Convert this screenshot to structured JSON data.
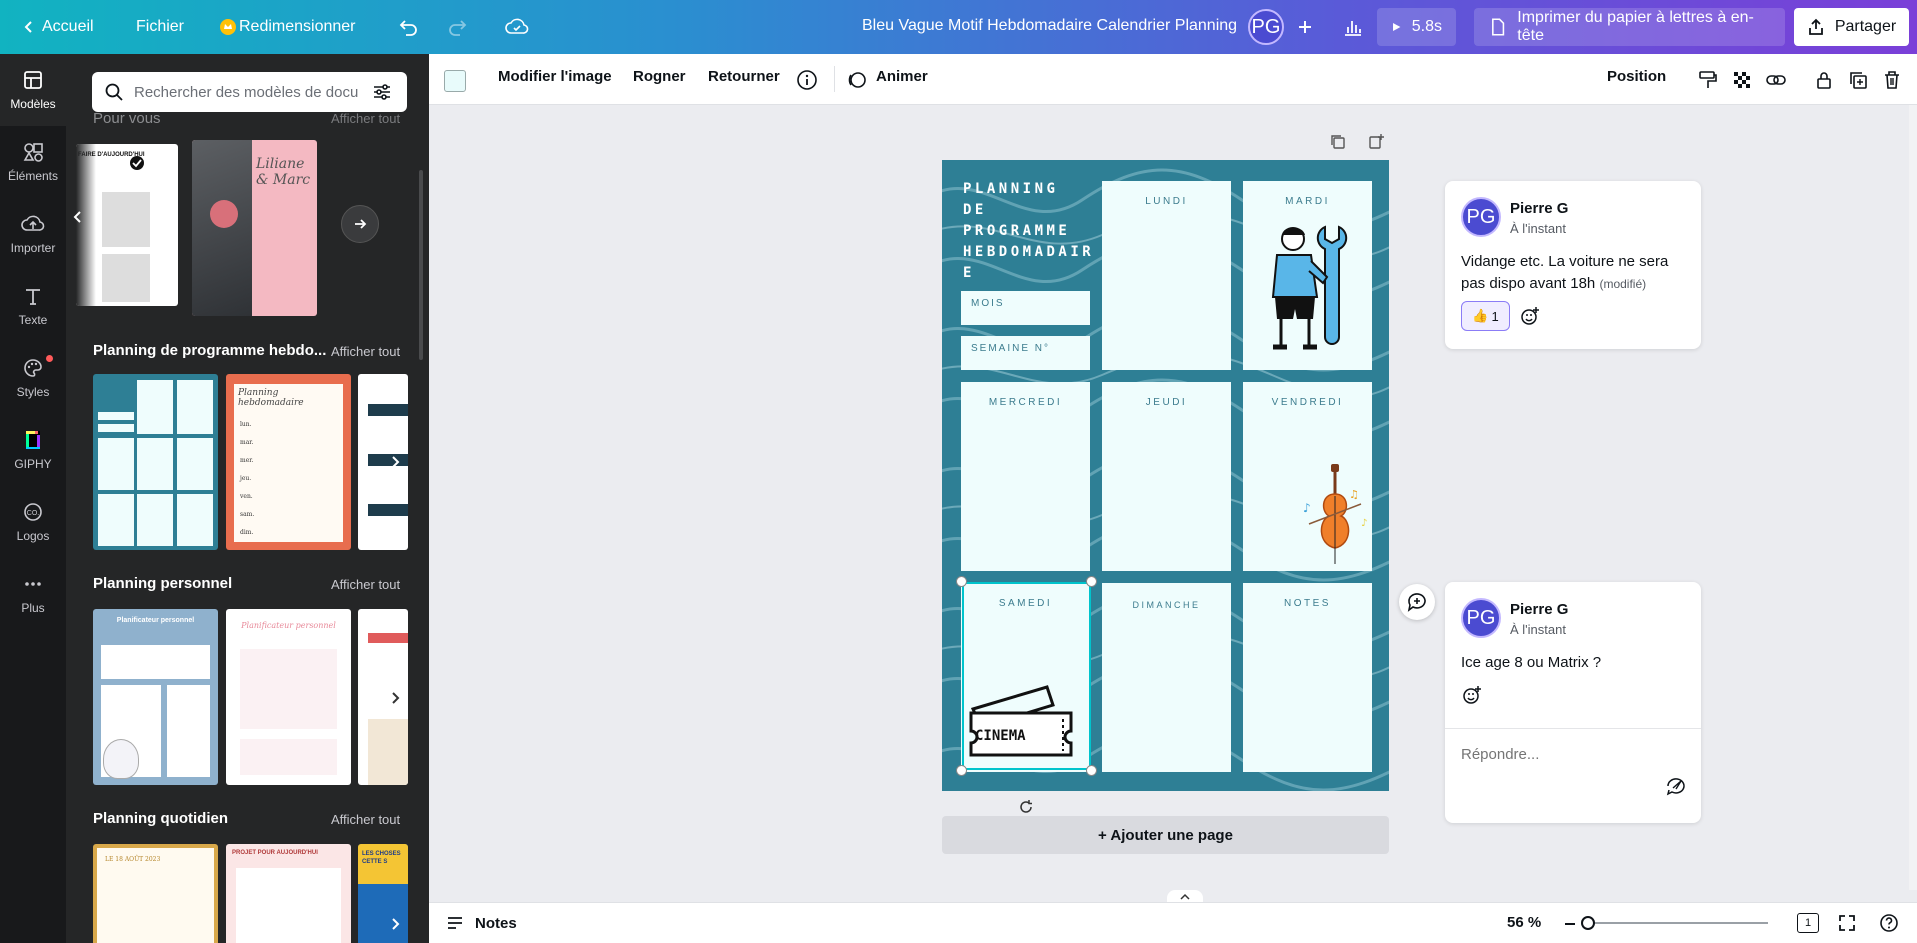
{
  "topbar": {
    "home_label": "Accueil",
    "file_label": "Fichier",
    "resize_label": "Redimensionner",
    "doc_title": "Bleu Vague Motif Hebdomadaire Calendrier Planning",
    "avatar_initials": "PG",
    "play_duration": "5.8s",
    "print_label": "Imprimer du papier à lettres à en-tête",
    "share_label": "Partager",
    "brand_gradient": [
      "#11b3c1",
      "#2a8fd0",
      "#5a5ad8",
      "#7a3fd8"
    ]
  },
  "rail": {
    "items": [
      {
        "label": "Modèles",
        "icon": "layout-icon"
      },
      {
        "label": "Éléments",
        "icon": "shapes-icon"
      },
      {
        "label": "Importer",
        "icon": "cloud-upload-icon"
      },
      {
        "label": "Texte",
        "icon": "text-icon"
      },
      {
        "label": "Styles",
        "icon": "palette-icon"
      },
      {
        "label": "GIPHY",
        "icon": "giphy-icon"
      },
      {
        "label": "Logos",
        "icon": "logo-icon"
      },
      {
        "label": "Plus",
        "icon": "more-dots-icon"
      }
    ]
  },
  "panel": {
    "search_placeholder": "Rechercher des modèles de docu",
    "sections": [
      {
        "title": "Pour vous",
        "link": "Afficher tout"
      },
      {
        "title": "Planning de programme hebdo...",
        "link": "Afficher tout"
      },
      {
        "title": "Planning personnel",
        "link": "Afficher tout"
      },
      {
        "title": "Planning quotidien",
        "link": "Afficher tout"
      }
    ],
    "thumb_texts": {
      "pourvous_1": "FAIRE D'AUJOURD'HUI",
      "pourvous_2_title": "Liliane & Marc",
      "hebdo_2": "Planning hebdomadaire",
      "hebdo_2_days": [
        "lun.",
        "mar.",
        "mer.",
        "jeu.",
        "ven.",
        "sam.",
        "dim."
      ],
      "perso_1": "Planificateur personnel",
      "perso_2": "Planificateur personnel",
      "quot_1": "LE 18 AOÛT 2023",
      "quot_2": "PROJET POUR AUJOURD'HUI",
      "quot_3": "LES CHOSES CETTE S"
    }
  },
  "context_toolbar": {
    "edit_image": "Modifier l'image",
    "crop": "Rogner",
    "flip": "Retourner",
    "animate": "Animer",
    "position": "Position",
    "selected_color": "#e8fbfb"
  },
  "planner": {
    "title": "PLANNING DE PROGRAMME HEBDOMADAIRE",
    "title_lines": [
      "PLANNING DE",
      "PROGRAMME",
      "HEBDOMADAIR",
      "E"
    ],
    "month_label": "MOIS",
    "week_label": "SEMAINE N°",
    "days": {
      "monday": "LUNDI",
      "tuesday": "MARDI",
      "wednesday": "MERCREDI",
      "thursday": "JEUDI",
      "friday": "VENDREDI",
      "saturday": "SAMEDI",
      "sunday": "DIMANCHE",
      "notes": "NOTES"
    },
    "cinema_text": "CINEMA",
    "bg_color": "#2e7f95",
    "cell_color": "#effdfd"
  },
  "canvas": {
    "add_page_label": "+ Ajouter une page"
  },
  "comments": [
    {
      "author": "Pierre G",
      "initials": "PG",
      "time": "À l'instant",
      "text": "Vidange etc. La voiture ne sera pas dispo avant 18h",
      "edited": "(modifié)",
      "reaction_emoji": "👍",
      "reaction_count": "1"
    },
    {
      "author": "Pierre G",
      "initials": "PG",
      "time": "À l'instant",
      "text": "Ice age 8 ou Matrix ?",
      "reply_placeholder": "Répondre..."
    }
  ],
  "footer": {
    "notes_label": "Notes",
    "zoom_level": "56 %",
    "zoom_fraction": 0.1,
    "page_count": "1"
  }
}
